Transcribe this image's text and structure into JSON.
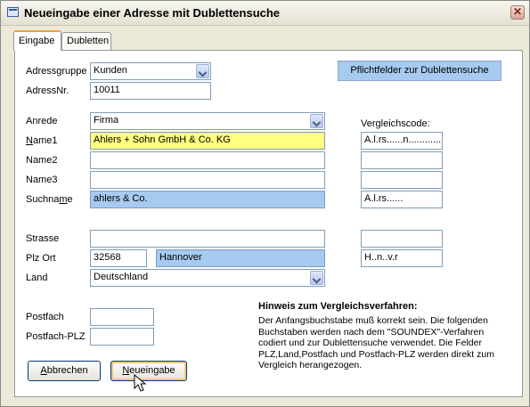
{
  "window": {
    "title": "Neueingabe einer Adresse mit Dublettensuche"
  },
  "tabs": [
    {
      "label": "Eingabe",
      "active": true
    },
    {
      "label": "Dubletten",
      "active": false
    }
  ],
  "form": {
    "adressgruppe": {
      "label": "Adressgruppe",
      "value": "Kunden"
    },
    "adressnr": {
      "label": "AdressNr.",
      "value": "10011"
    },
    "anrede": {
      "label": "Anrede",
      "value": "Firma"
    },
    "name1": {
      "label_pre": "N",
      "label_rest": "ame1",
      "value": "Ahlers + Sohn GmbH & Co. KG"
    },
    "name2": {
      "label": "Name2",
      "value": ""
    },
    "name3": {
      "label": "Name3",
      "value": ""
    },
    "suchname": {
      "label_pre": "Suchna",
      "label_ul": "m",
      "label_rest": "e",
      "value": "ahlers & Co."
    },
    "strasse": {
      "label": "Strasse",
      "value": ""
    },
    "plzort": {
      "label": "Plz Ort",
      "plz": "32568",
      "ort": "Hannover"
    },
    "land": {
      "label": "Land",
      "value": "Deutschland"
    },
    "postfach": {
      "label": "Postfach",
      "value": ""
    },
    "postfach_plz": {
      "label": "Postfach-PLZ",
      "value": ""
    }
  },
  "vergleich": {
    "header": "Vergleichscode:",
    "name1": "A.l.rs......n.............",
    "name2": "",
    "name3": "",
    "suchname": "A.l.rs......",
    "strasse": "",
    "plzort": "H..n..v.r"
  },
  "pflicht_label": "Pflichtfelder zur Dublettensuche",
  "hinweis": {
    "title": "Hinweis zum Vergleichsverfahren:",
    "text": "Der Anfangsbuchstabe muß korrekt sein. Die folgenden Buchstaben werden nach dem \"SOUNDEX\"-Verfahren codiert und zur Dublettensuche verwendet. Die Felder PLZ,Land,Postfach und Postfach-PLZ werden direkt zum Vergleich herangezogen."
  },
  "buttons": {
    "abbrechen": {
      "ul": "A",
      "rest": "bbrechen"
    },
    "neueingabe": {
      "ul": "N",
      "rest": "eueingabe"
    }
  },
  "colors": {
    "highlight_yellow": "#ffff80",
    "highlight_blue": "#a6caf0"
  }
}
